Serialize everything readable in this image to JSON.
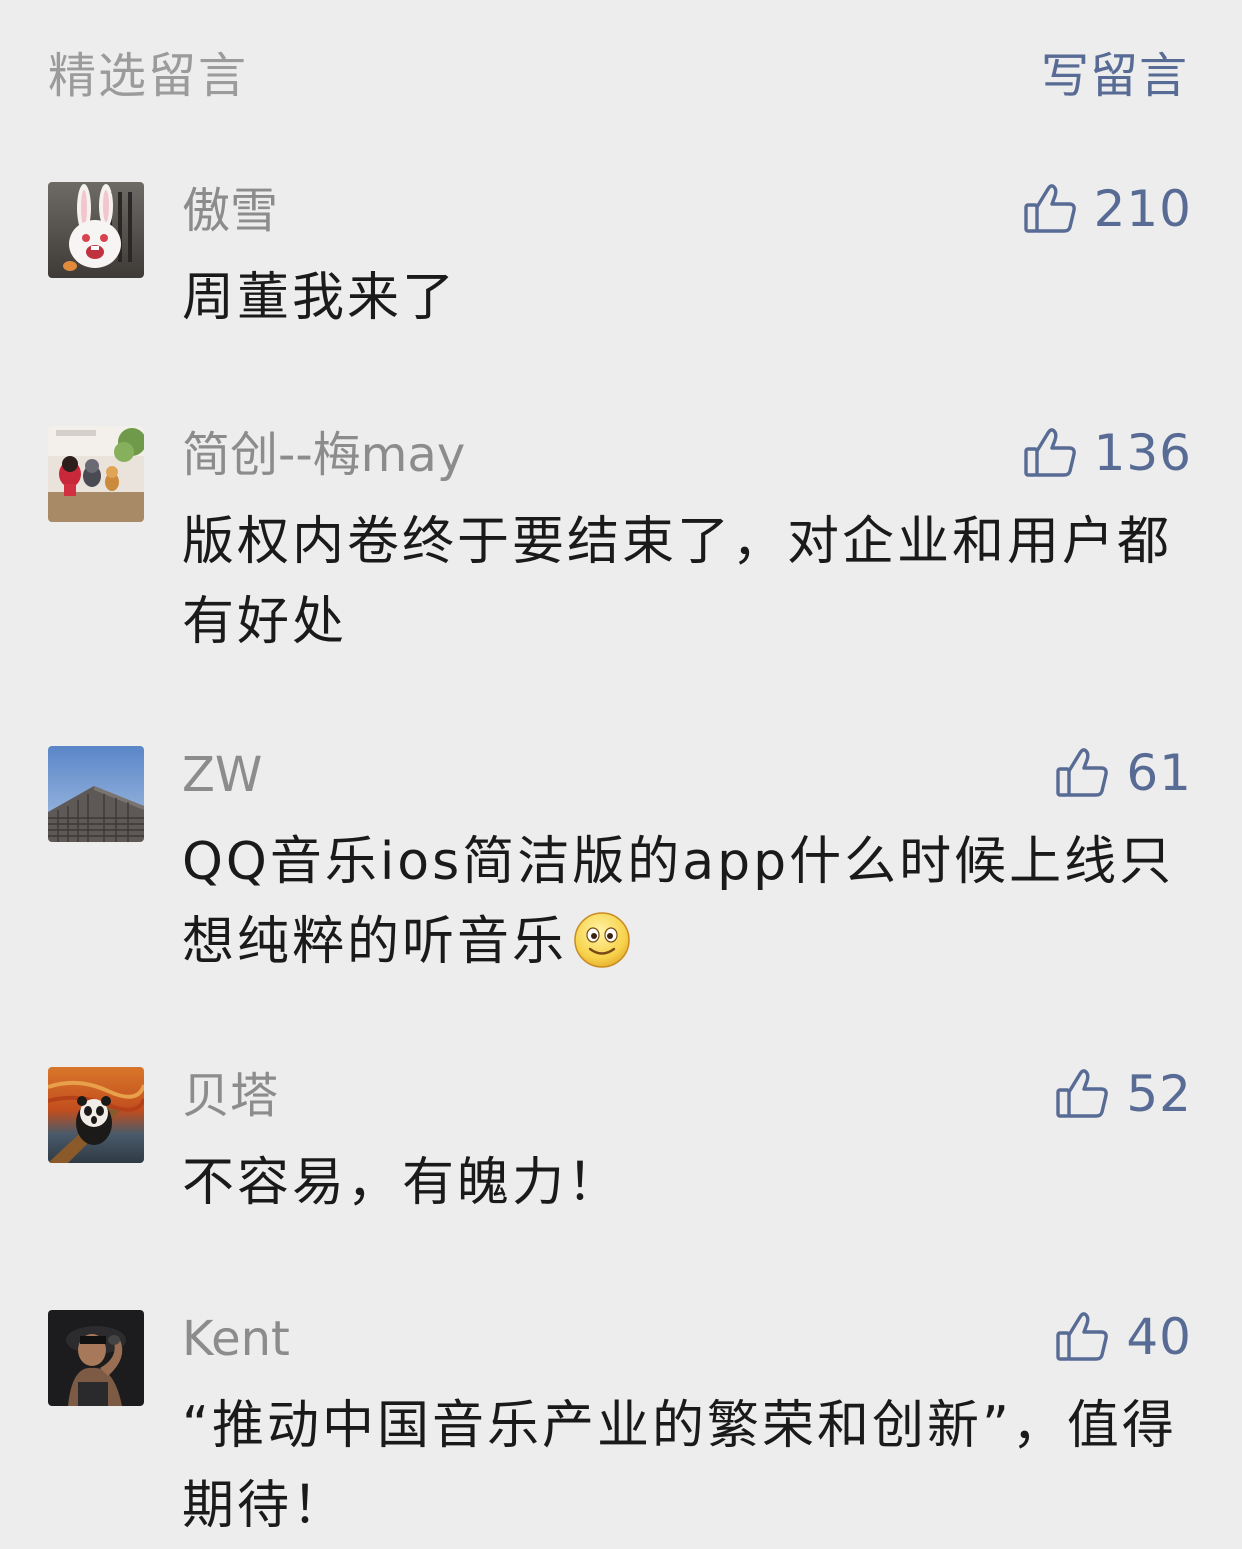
{
  "header": {
    "title": "精选留言",
    "write_button": "写留言"
  },
  "colors": {
    "background": "#ededed",
    "accent": "#576b95",
    "muted": "#9b9b9b",
    "text": "#1a1a1a"
  },
  "comments": [
    {
      "nickname": "傲雪",
      "likes": "210",
      "content": "周董我来了"
    },
    {
      "nickname": "简创--梅may",
      "likes": "136",
      "content": "版权内卷终于要结束了，对企业和用户都有好处"
    },
    {
      "nickname": "ZW",
      "likes": "61",
      "content": "QQ音乐ios简洁版的app什么时候上线只想纯粹的听音乐",
      "emoji": "smiley-emoji"
    },
    {
      "nickname": "贝塔",
      "likes": "52",
      "content": "不容易，有魄力！"
    },
    {
      "nickname": "Kent",
      "likes": "40",
      "content": "“推动中国音乐产业的繁荣和创新”，值得期待！"
    }
  ],
  "icons": {
    "like": "thumbs-up-icon",
    "emoji": "smiley-emoji"
  }
}
